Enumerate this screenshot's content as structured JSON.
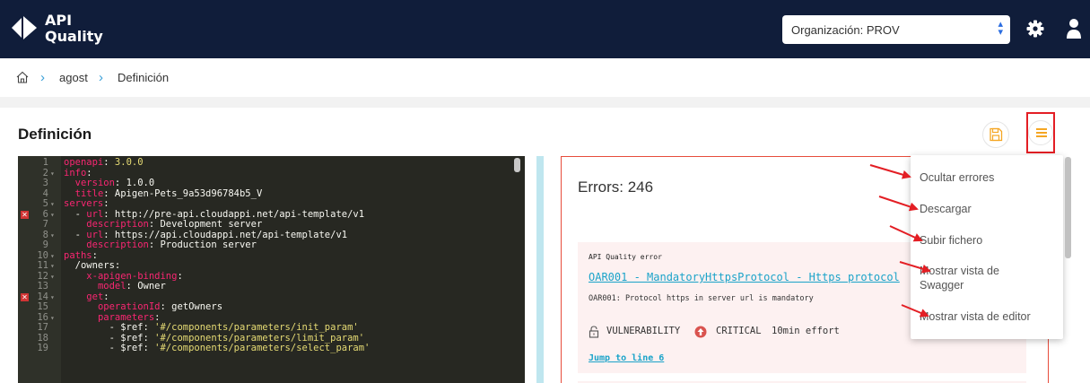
{
  "app": {
    "logo_line1": "API",
    "logo_line2": "Quality",
    "org_select_value": "Organización: PROV"
  },
  "breadcrumb": [
    "agost",
    "Definición"
  ],
  "page": {
    "title": "Definición"
  },
  "editor": {
    "lines": [
      {
        "n": "1",
        "fold": false,
        "error": false,
        "html": "<span class='k'>openapi</span>: <span class='s'>3.0.0</span>"
      },
      {
        "n": "2",
        "fold": true,
        "error": false,
        "html": "<span class='k'>info</span>:"
      },
      {
        "n": "3",
        "fold": false,
        "error": false,
        "html": "  <span class='k'>version</span>: 1.0.0"
      },
      {
        "n": "4",
        "fold": false,
        "error": false,
        "html": "  <span class='k'>title</span>: Apigen-Pets_9a53d96784b5_V"
      },
      {
        "n": "5",
        "fold": true,
        "error": false,
        "html": "<span class='k'>servers</span>:"
      },
      {
        "n": "6",
        "fold": true,
        "error": true,
        "html": "  - <span class='k'>url</span>: http://pre-api.cloudappi.net/api-template/v1"
      },
      {
        "n": "7",
        "fold": false,
        "error": false,
        "html": "    <span class='k'>description</span>: Development server"
      },
      {
        "n": "8",
        "fold": true,
        "error": false,
        "html": "  - <span class='k'>url</span>: https://api.cloudappi.net/api-template/v1"
      },
      {
        "n": "9",
        "fold": false,
        "error": false,
        "html": "    <span class='k'>description</span>: Production server"
      },
      {
        "n": "10",
        "fold": true,
        "error": false,
        "html": "<span class='k'>paths</span>:"
      },
      {
        "n": "11",
        "fold": true,
        "error": false,
        "html": "  /owners:"
      },
      {
        "n": "12",
        "fold": true,
        "error": false,
        "html": "    <span class='k'>x-apigen-binding</span>:"
      },
      {
        "n": "13",
        "fold": false,
        "error": false,
        "html": "      <span class='k'>model</span>: Owner"
      },
      {
        "n": "14",
        "fold": true,
        "error": true,
        "html": "    <span class='k'>get</span>:"
      },
      {
        "n": "15",
        "fold": false,
        "error": false,
        "html": "      <span class='k'>operationId</span>: getOwners"
      },
      {
        "n": "16",
        "fold": true,
        "error": false,
        "html": "      <span class='k'>parameters</span>:"
      },
      {
        "n": "17",
        "fold": false,
        "error": false,
        "html": "        - $ref: <span class='s'>'#/components/parameters/init_param'</span>"
      },
      {
        "n": "18",
        "fold": false,
        "error": false,
        "html": "        - $ref: <span class='s'>'#/components/parameters/limit_param'</span>"
      },
      {
        "n": "19",
        "fold": false,
        "error": false,
        "html": "        - $ref: <span class='s'>'#/components/parameters/select_param'</span>"
      }
    ]
  },
  "errors_panel": {
    "count_label": "Errors: 246",
    "first_error": {
      "header": "API Quality error",
      "link": "OAR001 - MandatoryHttpsProtocol - Https protocol",
      "description": "OAR001: Protocol https in server url is mandatory",
      "type": "VULNERABILITY",
      "severity": "CRITICAL",
      "effort": "10min effort",
      "jump": "Jump to line 6"
    }
  },
  "menu": {
    "items": [
      "Ocultar errores",
      "Descargar",
      "Subir fichero",
      "Mostrar vista de Swagger",
      "Mostrar vista de editor"
    ]
  },
  "colors": {
    "topbar": "#101d3a",
    "accent_orange": "#f5a623",
    "highlight_red": "#e31e24",
    "link_teal": "#1aa3c9"
  }
}
